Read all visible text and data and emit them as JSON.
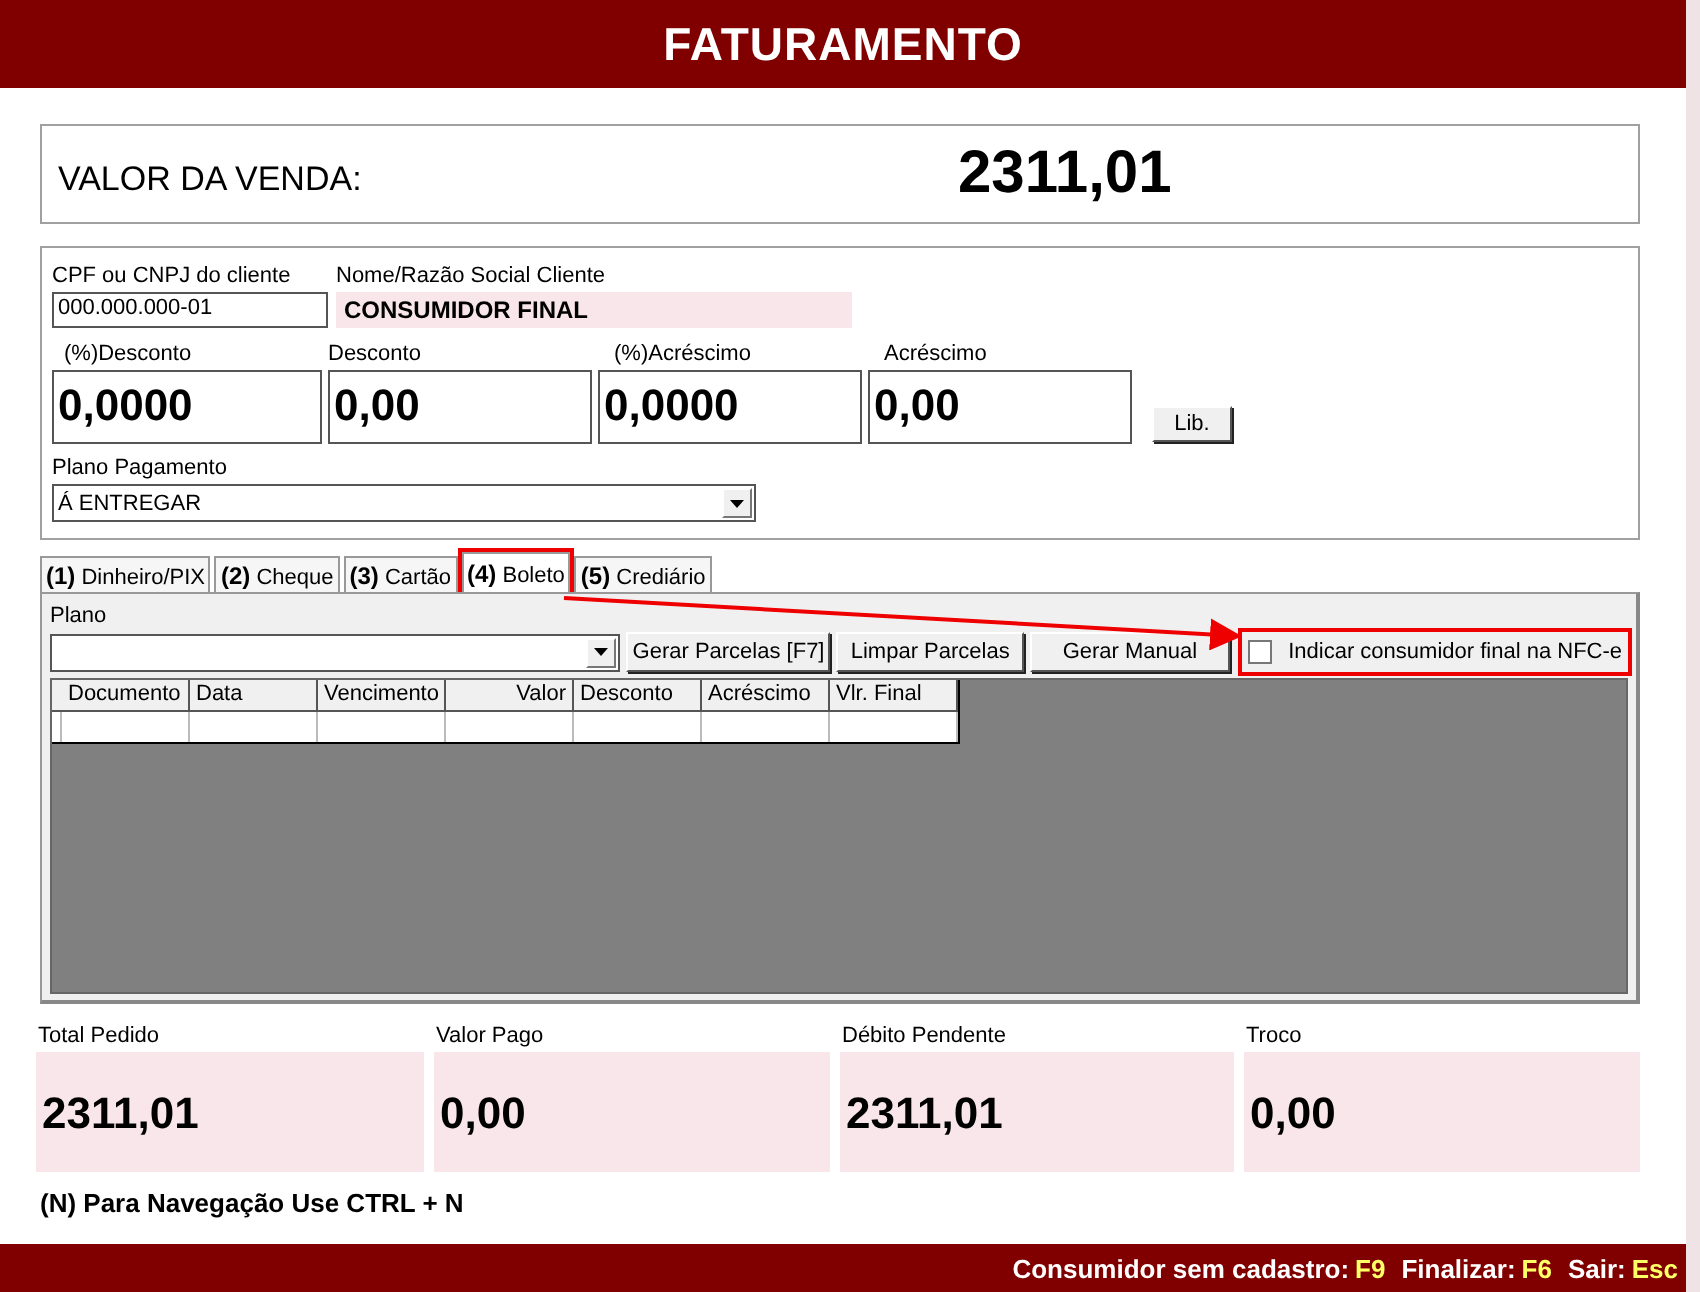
{
  "window": {
    "title": "FATURAMENTO"
  },
  "sale": {
    "label": "VALOR DA VENDA:",
    "value": "2311,01"
  },
  "client": {
    "document": {
      "label": "CPF ou CNPJ do cliente",
      "value": "000.000.000-01"
    },
    "name": {
      "label": "Nome/Razão Social Cliente",
      "value": "CONSUMIDOR FINAL"
    }
  },
  "adjustments": [
    {
      "label": "(%)Desconto",
      "value": "0,0000"
    },
    {
      "label": "Desconto",
      "value": "0,00"
    },
    {
      "label": "(%)Acréscimo",
      "value": "0,0000"
    },
    {
      "label": "Acréscimo",
      "value": "0,00"
    }
  ],
  "release_button": "Lib.",
  "payment_plan": {
    "label": "Plano Pagamento",
    "value": "Á ENTREGAR"
  },
  "tabs": [
    {
      "label": "**(1)** Dinheiro/PIX",
      "selected": false
    },
    {
      "label": "**(2)** Cheque",
      "selected": false
    },
    {
      "label": "**(3)** Cartão",
      "selected": false
    },
    {
      "label": "**(4)** Boleto",
      "selected": true,
      "highlighted": true
    },
    {
      "label": "**(5)** Crediário",
      "selected": false
    }
  ],
  "panel": {
    "plan_label": "Plano",
    "buttons": [
      "Gerar Parcelas [F7]",
      "Limpar Parcelas",
      "Gerar Manual"
    ],
    "checkbox": {
      "label": "Indicar consumidor final na NFC-e",
      "checked": false,
      "highlighted": true
    }
  },
  "table": {
    "columns": [
      "Documento",
      "Data",
      "Vencimento",
      "Valor",
      "Desconto",
      "Acréscimo",
      "Vlr. Final"
    ]
  },
  "totals": [
    {
      "label": "Total Pedido",
      "value": "2311,01"
    },
    {
      "label": "Valor Pago",
      "value": "0,00"
    },
    {
      "label": "Débito Pendente",
      "value": "2311,01"
    },
    {
      "label": "Troco",
      "value": "0,00"
    }
  ],
  "hint": "(N) Para Navegação Use CTRL + N",
  "status_bar": [
    {
      "label": "Consumidor sem cadastro:",
      "key": "F9"
    },
    {
      "label": "Finalizar:",
      "key": "F6"
    },
    {
      "label": "Sair:",
      "key": "Esc"
    }
  ]
}
